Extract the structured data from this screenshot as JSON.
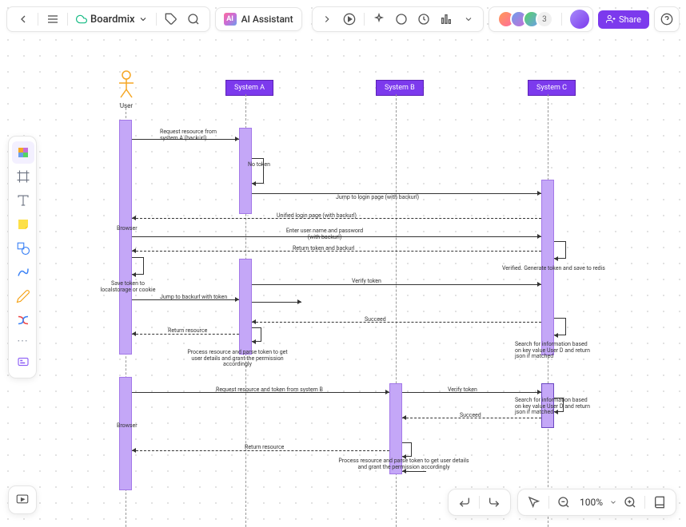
{
  "header": {
    "brand": "Boardmix",
    "ai_label": "AI Assistant",
    "avatar_count": "3",
    "share_label": "Share"
  },
  "footer": {
    "zoom": "100%"
  },
  "diagram": {
    "actors": {
      "user": "User",
      "systemA": "System A",
      "systemB": "System B",
      "systemC": "System C"
    },
    "browser": "Browser",
    "messages": {
      "m1": "Request resource from system A (backurl)",
      "m2": "No token",
      "m3": "Jump to login page  (with backurl)",
      "m4": "Unified login page (with backurl)",
      "m5": "Enter user name and password (with backurl)",
      "m6": "Return token and backurl",
      "m7": "Verified. Generate token and save to redis",
      "m8": "Save token to localstorage or cookie",
      "m9": "Jump to backurl with token",
      "m10": "Verify token",
      "m11": "Search for information based on key value User D and return json if matched",
      "m12": "Succeed",
      "m13": "Return resource",
      "m14": "Process resource and parse token to get user details and grant the permission accordingly",
      "m15": "Request resource and token from system B",
      "m16": "Verify token",
      "m17": "Search for information based on key value User D and return json if matched",
      "m18": "Succeed",
      "m19": "Return resource",
      "m20": "Process resource and parse token to get user details and grant the permission accordingly"
    }
  }
}
